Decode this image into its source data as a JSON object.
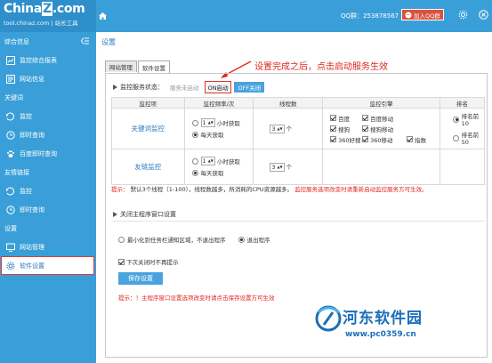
{
  "brand": {
    "logo_pre": "China",
    "logo_z": "Z",
    "logo_post": ".com",
    "sub": "tool.chinaz.com | 站长工具"
  },
  "topbar": {
    "qq_group": "QQ群：253878567",
    "qq_button": "加入QQ群"
  },
  "sidebar": {
    "sections": [
      {
        "title": "综合信息",
        "items": [
          {
            "label": "监控综合报表",
            "icon": "chart-icon"
          },
          {
            "label": "网站信息",
            "icon": "site-info-icon"
          }
        ]
      },
      {
        "title": "关键词",
        "items": [
          {
            "label": "监控",
            "icon": "monitor-icon"
          },
          {
            "label": "即时查询",
            "icon": "clock-icon"
          },
          {
            "label": "百度即时查询",
            "icon": "paw-icon"
          }
        ]
      },
      {
        "title": "友情链接",
        "items": [
          {
            "label": "监控",
            "icon": "monitor-icon"
          },
          {
            "label": "即时查询",
            "icon": "clock-icon"
          }
        ]
      },
      {
        "title": "设置",
        "items": [
          {
            "label": "网站管理",
            "icon": "globe-icon"
          },
          {
            "label": "软件设置",
            "icon": "gear-icon",
            "active": true
          }
        ]
      }
    ]
  },
  "main": {
    "title": "设置",
    "tabs": [
      {
        "label": "网站管理"
      },
      {
        "label": "软件设置",
        "active": true
      }
    ],
    "annotation": "设置完成之后，点击启动服务生效",
    "status": {
      "label": "监控服务状态：",
      "text": "服务未启动",
      "on_button": "ON启动",
      "off_button": "OFF关闭"
    },
    "table": {
      "headers": [
        "监控项",
        "监控频率/次",
        "线程数",
        "监控引擎",
        "排名"
      ],
      "rows": [
        {
          "category": "关键词监控",
          "hours_value": "1",
          "hours_unit": "小时获取",
          "daily": "每天获取",
          "threads": "3",
          "thread_unit": "个",
          "engines": [
            "百度",
            "百度移动",
            "",
            "搜狗",
            "搜狗移动",
            "",
            "360好搜",
            "360移动",
            "指数"
          ],
          "rank": [
            "排名前10",
            "排名前50"
          ]
        },
        {
          "category": "友链监控",
          "hours_value": "1",
          "hours_unit": "小时获取",
          "daily": "每天获取",
          "threads": "3",
          "thread_unit": "个"
        }
      ]
    },
    "tip1_prefix": "提示：",
    "tip1_body": "默认3个线程（1-100），线程数越多，所消耗的CPU资源越多。",
    "tip1_red": "监控服务选项改变时请重新启动监控服务方可生效。",
    "close_section": {
      "title": "关闭主程序窗口设置",
      "option1": "最小化到任务栏通知区域，不退出程序",
      "option2": "退出程序",
      "checkbox": "下次关闭时不再提示"
    },
    "save_button": "保存设置",
    "tip2": "提示：！主程序窗口设置选项改变时请点击保存设置方可生效"
  },
  "watermark": {
    "title": "河东软件园",
    "url": "www.pc0359.cn"
  },
  "colors": {
    "primary": "#3a9fd8",
    "accent_red": "#e0261f",
    "link_blue": "#2a7bbd"
  }
}
